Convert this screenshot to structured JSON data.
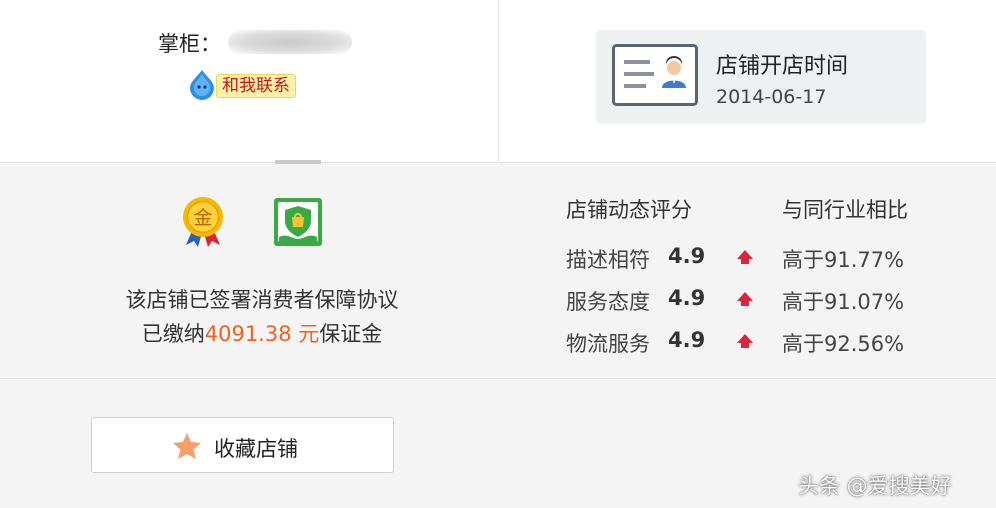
{
  "owner": {
    "label": "掌柜：",
    "contact_button": "和我联系"
  },
  "shop_open": {
    "title": "店铺开店时间",
    "date": "2014-06-17",
    "icon": "id-card-icon"
  },
  "badges": [
    {
      "name": "gold-medal-icon",
      "glyph": "金",
      "color": "#f4b400"
    },
    {
      "name": "consumer-protection-shield-icon",
      "color": "#39a845"
    }
  ],
  "guarantee": {
    "line1": "该店铺已签署消费者保障协议",
    "line2_prefix": "已缴纳",
    "amount": "4091.38 元",
    "line2_suffix": "保证金"
  },
  "ratings": {
    "header": "店铺动态评分",
    "compare_header": "与同行业相比",
    "items": [
      {
        "label": "描述相符",
        "score": "4.9",
        "trend": "up",
        "compare": "高于91.77%"
      },
      {
        "label": "服务态度",
        "score": "4.9",
        "trend": "up",
        "compare": "高于91.07%"
      },
      {
        "label": "物流服务",
        "score": "4.9",
        "trend": "up",
        "compare": "高于92.56%"
      }
    ]
  },
  "favorite": {
    "label": "收藏店铺",
    "icon": "star-icon"
  },
  "watermark": "头条 @爱搜美好",
  "colors": {
    "accent_orange": "#f0611d",
    "trend_up_red": "#d7263d",
    "contact_red": "#c6161a"
  }
}
